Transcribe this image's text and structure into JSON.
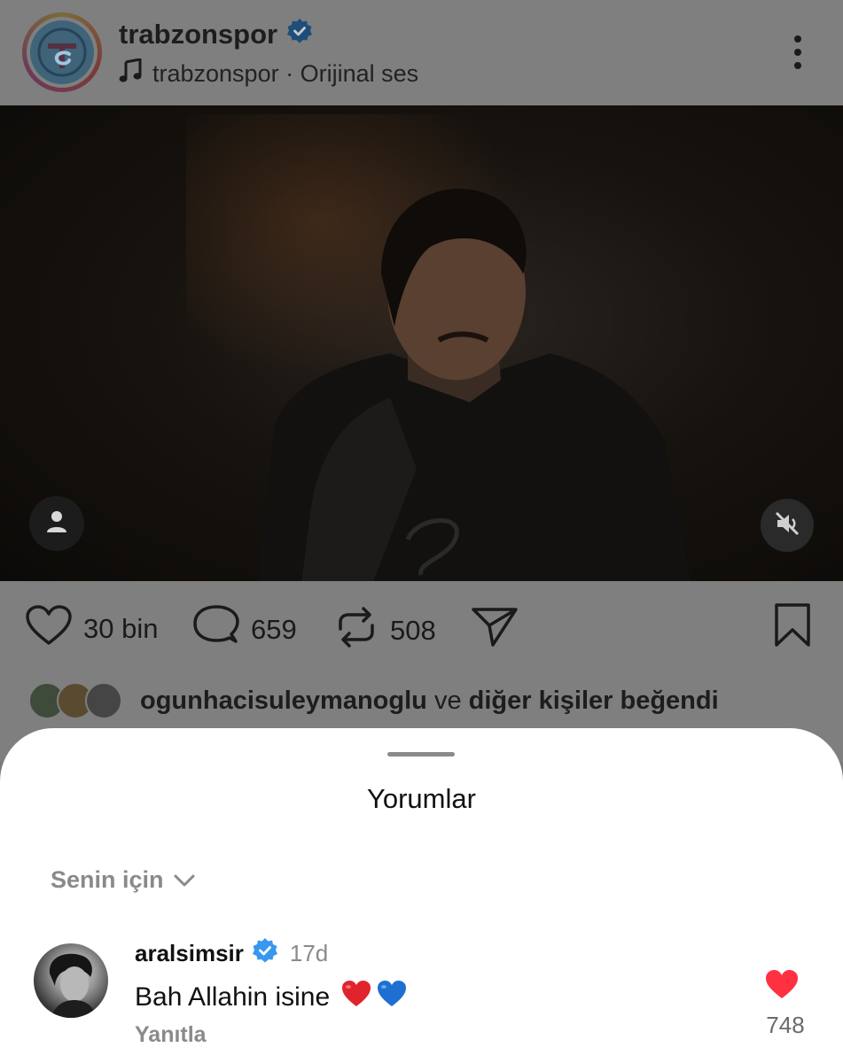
{
  "post": {
    "username": "trabzonspor",
    "verified": true,
    "audio_label": "trabzonspor · Orijinal ses",
    "icons": [
      "verified-badge-icon",
      "music-note-icon",
      "more-icon",
      "user-tag-icon",
      "muted-speaker-icon"
    ]
  },
  "actions": {
    "like_count": "30 bin",
    "comment_count": "659",
    "repost_count": "508",
    "icons": [
      "heart-icon",
      "comment-icon",
      "repost-icon",
      "share-icon",
      "bookmark-icon"
    ]
  },
  "likes": {
    "user": "ogunhacisuleymanoglu",
    "connector": "ve",
    "rest": "diğer kişiler beğendi"
  },
  "comments": {
    "title": "Yorumlar",
    "sort_label": "Senin için",
    "items": [
      {
        "username": "aralsimsir",
        "verified": true,
        "time": "17d",
        "text": "Bah Allahin isine",
        "emojis": [
          "red-heart",
          "blue-heart"
        ],
        "reply_label": "Yanıtla",
        "like_count": "748",
        "liked": true
      }
    ]
  },
  "colors": {
    "verified_blue": "#3897f0",
    "like_red": "#ff3040",
    "overlay_grey": "#7f7f7f"
  }
}
